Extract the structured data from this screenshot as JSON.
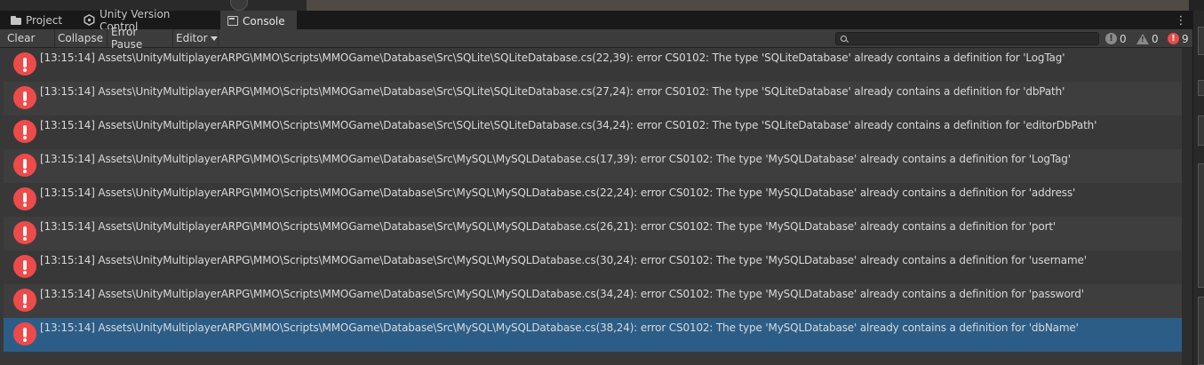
{
  "tabs": [
    {
      "label": "Project",
      "icon": "folder-icon"
    },
    {
      "label": "Unity Version Control",
      "icon": "version-control-icon"
    },
    {
      "label": "Console",
      "icon": "console-icon",
      "active": true
    }
  ],
  "toolbar": {
    "clear_label": "Clear",
    "collapse_label": "Collapse",
    "error_pause_label": "Error Pause",
    "editor_label": "Editor",
    "search_placeholder": "",
    "info_count": "0",
    "warning_count": "0",
    "error_count": "9"
  },
  "colors": {
    "error_red": "#ee4a4a",
    "selected_row": "#2c5d87",
    "toolbar_bg": "#3c3c3c"
  },
  "log_entries": [
    {
      "message": "[13:15:14] Assets\\UnityMultiplayerARPG\\MMO\\Scripts\\MMOGame\\Database\\Src\\SQLite\\SQLiteDatabase.cs(22,39): error CS0102: The type 'SQLiteDatabase' already contains a definition for 'LogTag'",
      "type": "error",
      "selected": false
    },
    {
      "message": "[13:15:14] Assets\\UnityMultiplayerARPG\\MMO\\Scripts\\MMOGame\\Database\\Src\\SQLite\\SQLiteDatabase.cs(27,24): error CS0102: The type 'SQLiteDatabase' already contains a definition for 'dbPath'",
      "type": "error",
      "selected": false
    },
    {
      "message": "[13:15:14] Assets\\UnityMultiplayerARPG\\MMO\\Scripts\\MMOGame\\Database\\Src\\SQLite\\SQLiteDatabase.cs(34,24): error CS0102: The type 'SQLiteDatabase' already contains a definition for 'editorDbPath'",
      "type": "error",
      "selected": false
    },
    {
      "message": "[13:15:14] Assets\\UnityMultiplayerARPG\\MMO\\Scripts\\MMOGame\\Database\\Src\\MySQL\\MySQLDatabase.cs(17,39): error CS0102: The type 'MySQLDatabase' already contains a definition for 'LogTag'",
      "type": "error",
      "selected": false
    },
    {
      "message": "[13:15:14] Assets\\UnityMultiplayerARPG\\MMO\\Scripts\\MMOGame\\Database\\Src\\MySQL\\MySQLDatabase.cs(22,24): error CS0102: The type 'MySQLDatabase' already contains a definition for 'address'",
      "type": "error",
      "selected": false
    },
    {
      "message": "[13:15:14] Assets\\UnityMultiplayerARPG\\MMO\\Scripts\\MMOGame\\Database\\Src\\MySQL\\MySQLDatabase.cs(26,21): error CS0102: The type 'MySQLDatabase' already contains a definition for 'port'",
      "type": "error",
      "selected": false
    },
    {
      "message": "[13:15:14] Assets\\UnityMultiplayerARPG\\MMO\\Scripts\\MMOGame\\Database\\Src\\MySQL\\MySQLDatabase.cs(30,24): error CS0102: The type 'MySQLDatabase' already contains a definition for 'username'",
      "type": "error",
      "selected": false
    },
    {
      "message": "[13:15:14] Assets\\UnityMultiplayerARPG\\MMO\\Scripts\\MMOGame\\Database\\Src\\MySQL\\MySQLDatabase.cs(34,24): error CS0102: The type 'MySQLDatabase' already contains a definition for 'password'",
      "type": "error",
      "selected": false
    },
    {
      "message": "[13:15:14] Assets\\UnityMultiplayerARPG\\MMO\\Scripts\\MMOGame\\Database\\Src\\MySQL\\MySQLDatabase.cs(38,24): error CS0102: The type 'MySQLDatabase' already contains a definition for 'dbName'",
      "type": "error",
      "selected": true
    }
  ]
}
